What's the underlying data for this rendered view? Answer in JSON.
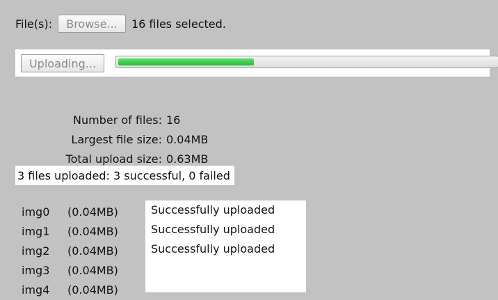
{
  "file_input": {
    "label": "File(s):",
    "browse_label": "Browse...",
    "selected_text": "16 files selected."
  },
  "upload": {
    "button_label": "Uploading...",
    "progress_fraction": 0.36,
    "progress_color": "#2cc73e"
  },
  "stats": [
    {
      "label": "Number of files:",
      "value": "16"
    },
    {
      "label": "Largest file size:",
      "value": "0.04MB"
    },
    {
      "label": "Total upload size:",
      "value": "0.63MB"
    }
  ],
  "summary": "3 files uploaded: 3 successful, 0 failed",
  "files": [
    {
      "name": "img0",
      "size": "(0.04MB)",
      "status": "Successfully uploaded"
    },
    {
      "name": "img1",
      "size": "(0.04MB)",
      "status": "Successfully uploaded"
    },
    {
      "name": "img2",
      "size": "(0.04MB)",
      "status": "Successfully uploaded"
    },
    {
      "name": "img3",
      "size": "(0.04MB)",
      "status": ""
    },
    {
      "name": "img4",
      "size": "(0.04MB)",
      "status": ""
    }
  ]
}
